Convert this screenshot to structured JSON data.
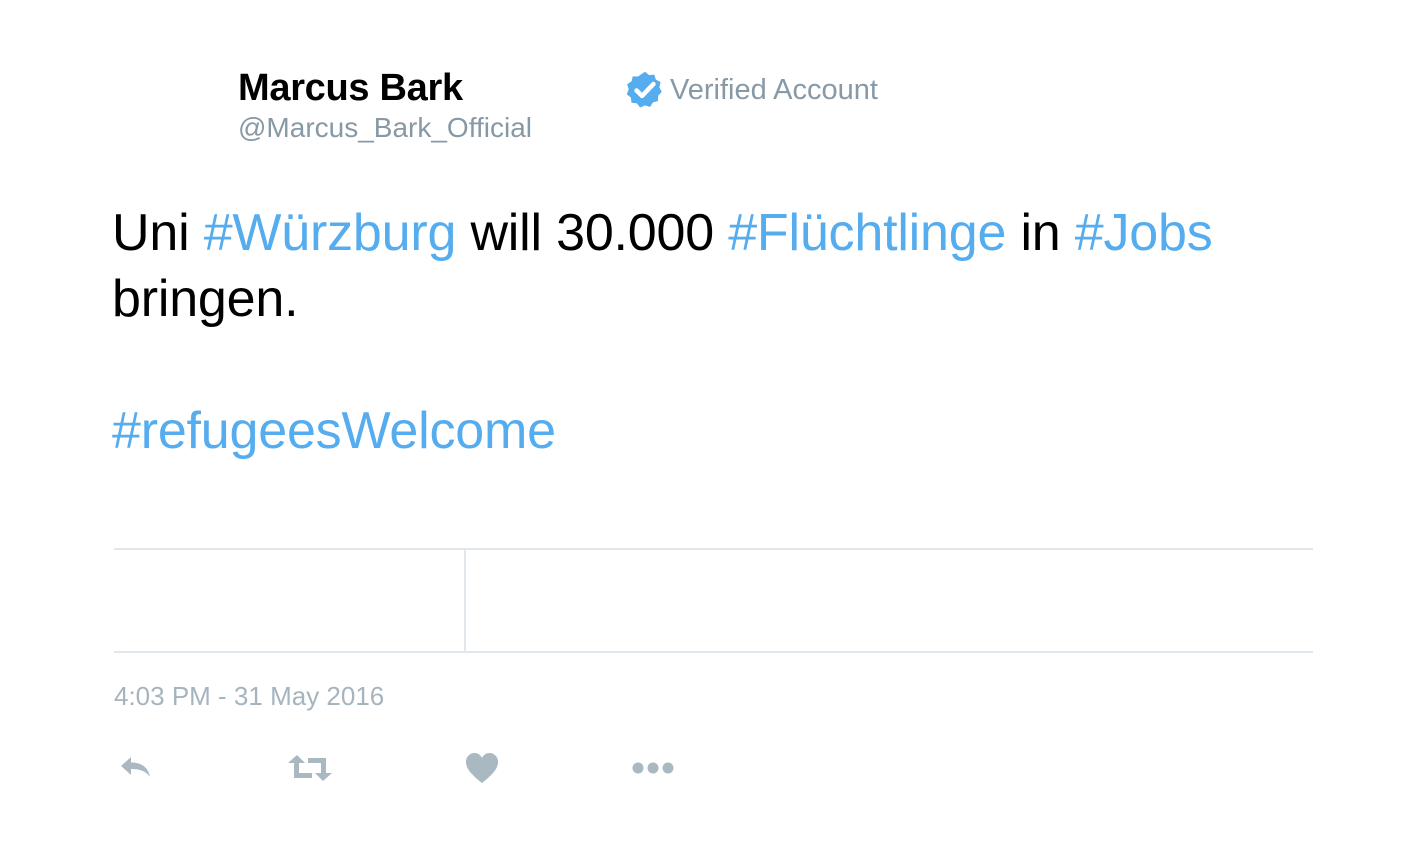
{
  "user": {
    "display_name": "Marcus Bark",
    "handle": "@Marcus_Bark_Official",
    "verified_label": "Verified Account",
    "verified_icon": "verified-badge-icon"
  },
  "tweet": {
    "lines": [
      [
        {
          "text": "Uni ",
          "type": "text"
        },
        {
          "text": "#Würzburg",
          "type": "hashtag"
        },
        {
          "text": " will 30.000 ",
          "type": "text"
        },
        {
          "text": "#Flüchtlinge",
          "type": "hashtag"
        },
        {
          "text": " in ",
          "type": "text"
        },
        {
          "text": "#Jobs",
          "type": "hashtag"
        }
      ],
      [
        {
          "text": "bringen.",
          "type": "text"
        }
      ],
      [],
      [
        {
          "text": "#refugeesWelcome",
          "type": "hashtag"
        }
      ]
    ],
    "timestamp": "4:03 PM - 31 May 2016"
  },
  "actions": [
    {
      "name": "reply",
      "icon": "reply-icon"
    },
    {
      "name": "retweet",
      "icon": "retweet-icon"
    },
    {
      "name": "like",
      "icon": "heart-icon"
    },
    {
      "name": "more",
      "icon": "more-dots-icon"
    }
  ],
  "colors": {
    "hashtag": "#55acee",
    "secondary_text": "#8899a6",
    "icon": "#aab8c2",
    "divider": "#e1e8ed",
    "verified_badge": "#55acee"
  }
}
